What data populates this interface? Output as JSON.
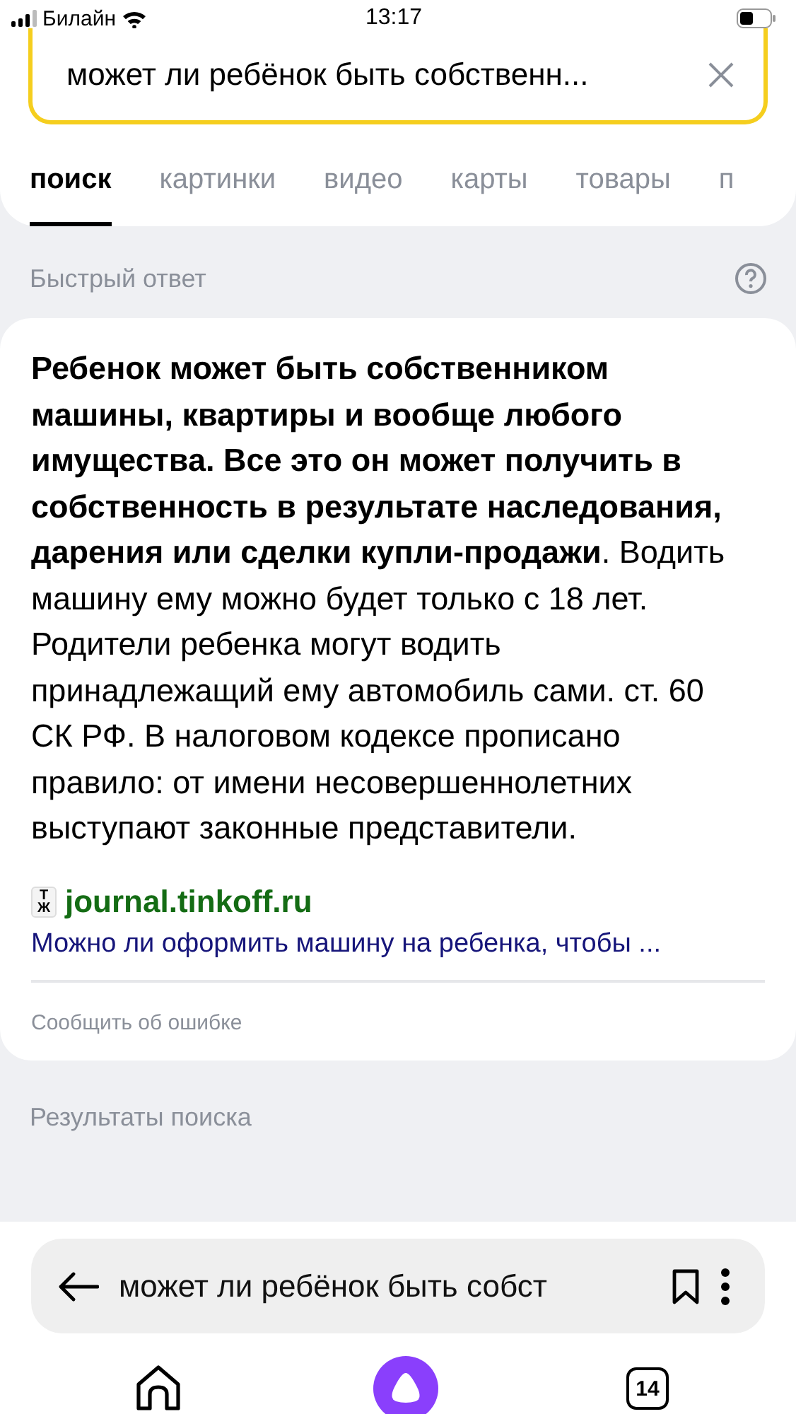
{
  "status_bar": {
    "carrier": "Билайн",
    "time": "13:17"
  },
  "search": {
    "value": "может ли ребёнок быть собственн..."
  },
  "tabs": [
    {
      "label": "поиск",
      "selected": true
    },
    {
      "label": "картинки",
      "selected": false
    },
    {
      "label": "видео",
      "selected": false
    },
    {
      "label": "карты",
      "selected": false
    },
    {
      "label": "товары",
      "selected": false
    },
    {
      "label": "п",
      "selected": false
    }
  ],
  "quick_answer": {
    "heading": "Быстрый ответ",
    "text": "**Ребенок может быть собственником машины, квартиры и вообще любого имущества. Все это он может получить в собственность в результате наследования, дарения или сделки купли-продажи**. Водить машину ему можно будет только с 18 лет. Родители ребенка могут водить принадлежащий ему автомобиль сами. ст. 60 СК РФ. В налоговом кодексе прописано правило: от имени несовершеннолетних выступают законные представители.",
    "source": {
      "favicon": "ТЖ",
      "domain": "journal.tinkoff.ru",
      "title": "Можно ли оформить машину на ребенка, чтобы ..."
    },
    "report": "Сообщить об ошибке"
  },
  "results_heading": "Результаты поиска",
  "address_bar": {
    "text": "может ли ребёнок быть собст"
  },
  "nav": {
    "tabs_count": "14"
  }
}
